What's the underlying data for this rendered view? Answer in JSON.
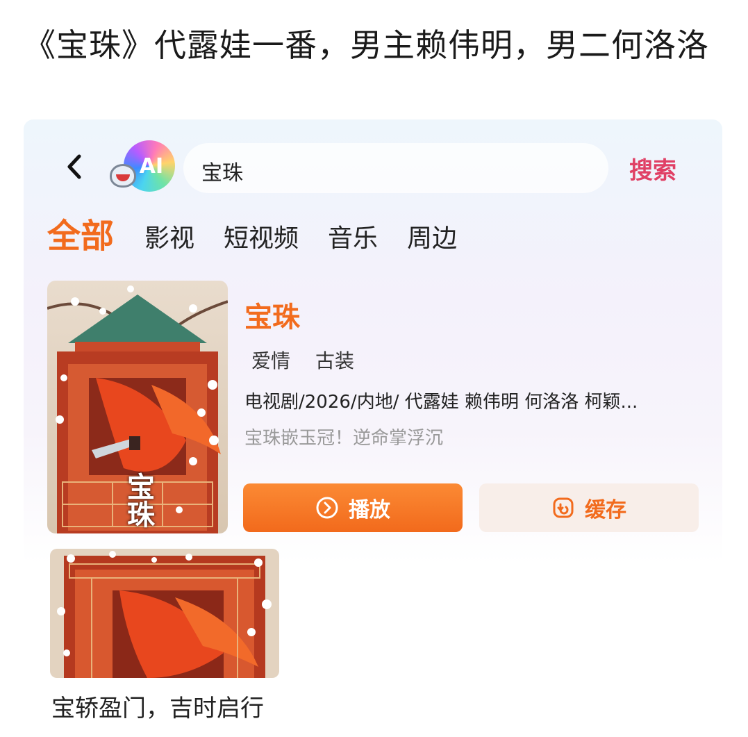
{
  "post": {
    "title": "《宝珠》代露娃一番，男主赖伟明，男二何洛洛",
    "caption": "宝轿盈门，吉时启行"
  },
  "search": {
    "query": "宝珠",
    "search_label": "搜索",
    "logo_text": "AI"
  },
  "tabs": [
    {
      "label": "全部",
      "active": true
    },
    {
      "label": "影视",
      "active": false
    },
    {
      "label": "短视频",
      "active": false
    },
    {
      "label": "音乐",
      "active": false
    },
    {
      "label": "周边",
      "active": false
    }
  ],
  "result": {
    "title": "宝珠",
    "genres": [
      "爱情",
      "古装"
    ],
    "meta": "电视剧/2026/内地/ 代露娃 赖伟明 何洛洛 柯颖...",
    "tagline": "宝珠嵌玉冠！逆命掌浮沉",
    "poster_text": "宝珠",
    "play_label": "播放",
    "cache_label": "缓存"
  },
  "colors": {
    "accent": "#f26b1d",
    "search_btn": "#e04065",
    "play_top": "#fb8a34",
    "play_bottom": "#f26a1c"
  },
  "icons": {
    "back": "chevron-left-icon",
    "play": "play-circle-icon",
    "cache": "download-cache-icon"
  }
}
